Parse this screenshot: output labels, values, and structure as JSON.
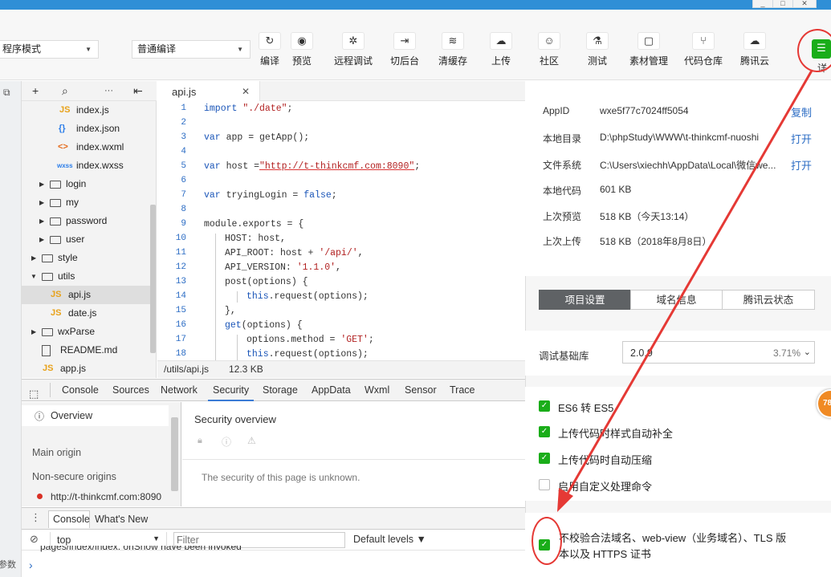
{
  "window": {
    "minimize": "_",
    "restore": "□",
    "close": "✕"
  },
  "toolbar": {
    "mode_select": "程序模式",
    "compile_select": "普通编译",
    "buttons": [
      {
        "label": "编译",
        "icon": "↻"
      },
      {
        "label": "预览",
        "icon": "◉"
      },
      {
        "label": "远程调试",
        "icon": "✲"
      },
      {
        "label": "切后台",
        "icon": "⇥"
      },
      {
        "label": "清缓存",
        "icon": "≋"
      },
      {
        "label": "上传",
        "icon": "☁"
      },
      {
        "label": "社区",
        "icon": "☺"
      },
      {
        "label": "测试",
        "icon": "⚗"
      },
      {
        "label": "素材管理",
        "icon": "▢"
      },
      {
        "label": "代码仓库",
        "icon": "⑂"
      },
      {
        "label": "腾讯云",
        "icon": "☁"
      }
    ],
    "detail_label": "详",
    "detail_icon": "☰"
  },
  "tree_header": {
    "add": "+",
    "search": "⌕",
    "more": "···",
    "collapse": "⇤"
  },
  "tree": [
    {
      "name": "index.js",
      "type": "js",
      "icon": "JS"
    },
    {
      "name": "index.json",
      "type": "json",
      "icon": "{}"
    },
    {
      "name": "index.wxml",
      "type": "wxml",
      "icon": "<>"
    },
    {
      "name": "index.wxss",
      "type": "wxss",
      "icon": "wxss"
    },
    {
      "name": "login",
      "type": "folder",
      "arrow": "▶"
    },
    {
      "name": "my",
      "type": "folder",
      "arrow": "▶"
    },
    {
      "name": "password",
      "type": "folder",
      "arrow": "▶"
    },
    {
      "name": "user",
      "type": "folder",
      "arrow": "▶"
    },
    {
      "name": "style",
      "type": "folder",
      "arrow": "▶"
    },
    {
      "name": "utils",
      "type": "folder",
      "arrow": "▼"
    },
    {
      "name": "api.js",
      "type": "js",
      "icon": "JS"
    },
    {
      "name": "date.js",
      "type": "js",
      "icon": "JS"
    },
    {
      "name": "wxParse",
      "type": "folder",
      "arrow": "▶"
    },
    {
      "name": "README.md",
      "type": "file"
    },
    {
      "name": "app.js",
      "type": "js",
      "icon": "JS"
    }
  ],
  "editor": {
    "tab_label": "api.js",
    "tab_close": "✕",
    "lines": [
      "1",
      "2",
      "3",
      "4",
      "5",
      "6",
      "7",
      "8",
      "9",
      "10",
      "11",
      "12",
      "13",
      "14",
      "15",
      "16",
      "17",
      "18"
    ],
    "status_path": "/utils/api.js",
    "status_size": "12.3 KB"
  },
  "devtools": {
    "inspect_icon": "⬚",
    "tabs": [
      "Console",
      "Sources",
      "Network",
      "Security",
      "Storage",
      "AppData",
      "Wxml",
      "Sensor",
      "Trace"
    ],
    "active_tab": "Security",
    "sidebar": {
      "overview": "Overview",
      "main_origin": "Main origin",
      "non_secure": "Non-secure origins",
      "origin_url": "http://t-thinkcmf.com:8090"
    },
    "security_title": "Security overview",
    "security_msg": "The security of this page is unknown.",
    "console_tabs": [
      "Console",
      "What's New"
    ],
    "console_menu": "⋮",
    "clear_icon": "⊘",
    "context": "top",
    "filter_placeholder": "Filter",
    "levels": "Default levels ▼",
    "log_line": "pages/index/index: onShow have been invoked",
    "prompt": "›",
    "left_cut": "参数"
  },
  "details": {
    "rows": [
      {
        "label": "AppID",
        "value": "wxe5f77c7024ff5054",
        "link": "复制"
      },
      {
        "label": "本地目录",
        "value": "D:\\phpStudy\\WWW\\t-thinkcmf-nuoshi",
        "link": "打开"
      },
      {
        "label": "文件系统",
        "value": "C:\\Users\\xiechh\\AppData\\Local\\微信we...",
        "link": "打开"
      },
      {
        "label": "本地代码",
        "value": "601 KB",
        "link": ""
      },
      {
        "label": "上次预览",
        "value": "518 KB（今天13:14）",
        "link": ""
      },
      {
        "label": "上次上传",
        "value": "518 KB（2018年8月8日）",
        "link": ""
      }
    ],
    "segments": [
      "项目设置",
      "域名信息",
      "腾讯云状态"
    ],
    "active_segment": "项目设置",
    "base_lib_label": "调试基础库",
    "base_lib_value": "2.0.9",
    "base_lib_pct": "3.71%",
    "checks": [
      {
        "label": "ES6 转 ES5",
        "checked": true
      },
      {
        "label": "上传代码时样式自动补全",
        "checked": true
      },
      {
        "label": "上传代码时自动压缩",
        "checked": true
      },
      {
        "label": "启用自定义处理命令",
        "checked": false
      }
    ],
    "domain_check_1": "不校验合法域名、web-view（业务域名）、TLS 版",
    "domain_check_2": "本以及 HTTPS 证书",
    "domain_checked": true,
    "badge": "78"
  },
  "colors": {
    "accent": "#1aad19",
    "link": "#2b6cc4",
    "annotation": "#e53935"
  }
}
